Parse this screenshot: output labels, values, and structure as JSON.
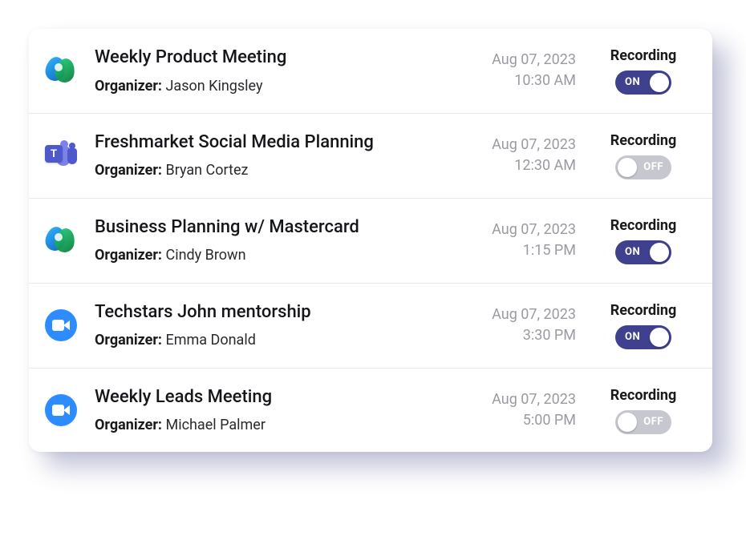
{
  "labels": {
    "organizer": "Organizer:",
    "recording": "Recording",
    "on": "ON",
    "off": "OFF"
  },
  "meetings": [
    {
      "platform": "webex",
      "title": "Weekly Product Meeting",
      "organizer": "Jason Kingsley",
      "date": "Aug 07, 2023",
      "time": "10:30 AM",
      "recording": true
    },
    {
      "platform": "teams",
      "title": "Freshmarket Social Media Planning",
      "organizer": "Bryan Cortez",
      "date": "Aug 07, 2023",
      "time": "12:30 AM",
      "recording": false
    },
    {
      "platform": "webex",
      "title": "Business Planning w/ Mastercard",
      "organizer": "Cindy Brown",
      "date": "Aug 07, 2023",
      "time": "1:15 PM",
      "recording": true
    },
    {
      "platform": "zoom",
      "title": "Techstars John mentorship",
      "organizer": "Emma Donald",
      "date": "Aug 07, 2023",
      "time": "3:30 PM",
      "recording": true
    },
    {
      "platform": "zoom",
      "title": "Weekly Leads Meeting",
      "organizer": "Michael Palmer",
      "date": "Aug 07, 2023",
      "time": "5:00 PM",
      "recording": false
    }
  ]
}
